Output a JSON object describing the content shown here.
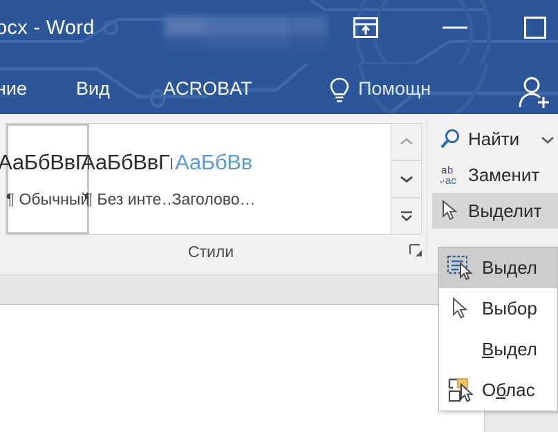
{
  "window": {
    "title": "ocx - Word",
    "redacted_account": "blurred-account-name",
    "colors": {
      "titlebar_blue": "#2b579a",
      "ribbon_bg": "#f1f1f1",
      "heading_style_blue": "#5b9bd5",
      "hover_gray": "#d6d6d6",
      "menu_highlight": "#cdcdcd"
    },
    "buttons": [
      {
        "name": "ribbon-display-options",
        "icon": "ribbon-display-options-icon",
        "label": ""
      },
      {
        "name": "minimize",
        "icon": "minimize-icon",
        "label": ""
      },
      {
        "name": "maximize",
        "icon": "maximize-icon",
        "label": ""
      }
    ]
  },
  "tabs": [
    {
      "label": "ние",
      "name": "tab-recenzirovanie"
    },
    {
      "label": "Вид",
      "name": "tab-vid"
    },
    {
      "label": "ACROBAT",
      "name": "tab-acrobat"
    }
  ],
  "tellme": {
    "label": "Помощн",
    "icon": "lightbulb-icon"
  },
  "share": {
    "icon": "share-person-icon"
  },
  "ribbon": {
    "styles_group": {
      "label": "Стили",
      "dialog_launcher": "dialog-launcher-icon",
      "items": [
        {
          "sample": "АаБбВвГг,",
          "name": "¶ Обычный",
          "selected": true,
          "heading": false
        },
        {
          "sample": "АаБбВвГг,",
          "name": "¶ Без инте…",
          "selected": false,
          "heading": false
        },
        {
          "sample": "АаБбВв",
          "name": "Заголово…",
          "selected": false,
          "heading": true
        }
      ],
      "scroll_buttons": [
        {
          "name": "styles-scroll-up",
          "icon": "chevron-up-icon"
        },
        {
          "name": "styles-scroll-down",
          "icon": "chevron-down-icon"
        },
        {
          "name": "styles-more",
          "icon": "more-styles-icon"
        }
      ]
    },
    "editing_group": {
      "buttons": [
        {
          "label": "Найти",
          "name": "find-button",
          "icon": "magnifier-icon",
          "has_caret": true,
          "hot": false
        },
        {
          "label": "Заменит",
          "name": "replace-button",
          "icon": "replace-abac-icon",
          "has_caret": false,
          "hot": false
        },
        {
          "label": "Выделит",
          "name": "select-button",
          "icon": "cursor-arrow-icon",
          "has_caret": false,
          "hot": true
        }
      ]
    }
  },
  "select_menu": {
    "items": [
      {
        "label": "Выдел",
        "name": "menu-select-all",
        "icon": "select-all-icon",
        "highlighted": true,
        "underline_index": -1
      },
      {
        "label": "Выбор",
        "name": "menu-select-objects",
        "icon": "cursor-arrow-icon",
        "highlighted": false,
        "underline_index": -1
      },
      {
        "label": "Выдел",
        "name": "menu-select-similar-formatting",
        "icon": "",
        "highlighted": false,
        "underline_index": 0
      },
      {
        "label": "Облас",
        "name": "menu-selection-pane",
        "icon": "selection-pane-icon",
        "highlighted": false,
        "underline_index": 1
      }
    ]
  }
}
